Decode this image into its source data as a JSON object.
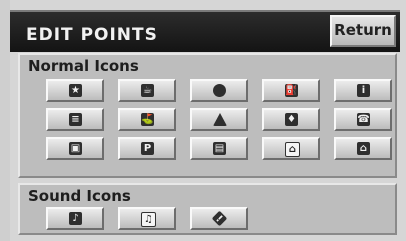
{
  "header": {
    "title": "EDIT POINTS",
    "return_label": "Return"
  },
  "normal": {
    "label": "Normal Icons",
    "icons": [
      {
        "name": "star-icon",
        "glyph": "★",
        "style": ""
      },
      {
        "name": "coffee-icon",
        "glyph": "☕",
        "style": ""
      },
      {
        "name": "ball-icon",
        "glyph": "",
        "style": "circle"
      },
      {
        "name": "gas-icon",
        "glyph": "⛽",
        "style": ""
      },
      {
        "name": "info-icon",
        "glyph": "i",
        "style": ""
      },
      {
        "name": "bed-icon",
        "glyph": "≡",
        "style": ""
      },
      {
        "name": "golf-icon",
        "glyph": "⛳",
        "style": ""
      },
      {
        "name": "bell-icon",
        "glyph": "",
        "style": "tri"
      },
      {
        "name": "shopping-icon",
        "glyph": "♦",
        "style": ""
      },
      {
        "name": "phone-icon",
        "glyph": "☎",
        "style": ""
      },
      {
        "name": "luggage-icon",
        "glyph": "▣",
        "style": ""
      },
      {
        "name": "parking-icon",
        "glyph": "P",
        "style": ""
      },
      {
        "name": "office-icon",
        "glyph": "▤",
        "style": ""
      },
      {
        "name": "bank-icon",
        "glyph": "⌂",
        "style": "white"
      },
      {
        "name": "home-icon",
        "glyph": "⌂",
        "style": ""
      }
    ]
  },
  "sound": {
    "label": "Sound Icons",
    "icons": [
      {
        "name": "music-note-icon",
        "glyph": "♪",
        "style": ""
      },
      {
        "name": "music-notes-icon",
        "glyph": "♫",
        "style": "white"
      },
      {
        "name": "warning-icon",
        "glyph": "!",
        "style": "diamond"
      }
    ]
  }
}
